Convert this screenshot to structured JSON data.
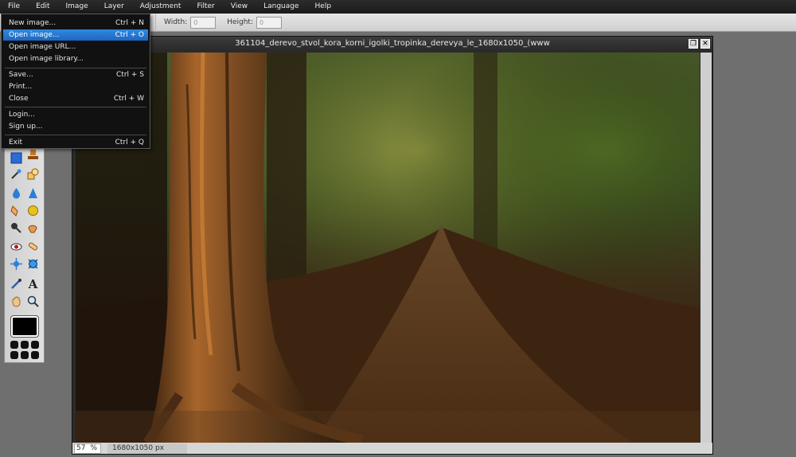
{
  "menubar": {
    "items": [
      "File",
      "Edit",
      "Image",
      "Layer",
      "Adjustment",
      "Filter",
      "View",
      "Language",
      "Help"
    ]
  },
  "options": {
    "width_label": "Width:",
    "width_value": "0",
    "height_label": "Height:",
    "height_value": "0"
  },
  "file_menu": {
    "items": [
      {
        "label": "New image...",
        "shortcut": "Ctrl + N"
      },
      {
        "label": "Open image...",
        "shortcut": "Ctrl + O"
      },
      {
        "label": "Open image URL...",
        "shortcut": ""
      },
      {
        "label": "Open image library...",
        "shortcut": ""
      },
      {
        "label": "Save...",
        "shortcut": "Ctrl + S"
      },
      {
        "label": "Print...",
        "shortcut": ""
      },
      {
        "label": "Close",
        "shortcut": "Ctrl + W"
      },
      {
        "label": "Login...",
        "shortcut": ""
      },
      {
        "label": "Sign up...",
        "shortcut": ""
      },
      {
        "label": "Exit",
        "shortcut": "Ctrl + Q"
      }
    ],
    "active_index": 1
  },
  "image_window": {
    "title": "361104_derevo_stvol_kora_korni_igolki_tropinka_derevya_le_1680x1050_(www",
    "restore_glyph": "❐",
    "close_glyph": "✕",
    "zoom_value": "57",
    "zoom_unit": "%",
    "dimensions": "1680x1050 px"
  },
  "tools": {
    "icons": [
      "marquee-tool-icon",
      "stamp-tool-icon",
      "wand-tool-icon",
      "shape-tool-icon",
      "blur-tool-icon",
      "sharpen-tool-icon",
      "smudge-tool-icon",
      "sponge-tool-icon",
      "dodge-tool-icon",
      "burn-tool-icon",
      "red-eye-tool-icon",
      "spot-heal-tool-icon",
      "bloat-tool-icon",
      "pinch-tool-icon",
      "color-picker-tool-icon",
      "type-tool-icon",
      "hand-tool-icon",
      "zoom-tool-icon"
    ],
    "type_glyph": "A"
  },
  "colors": {
    "menu_active": "#2f8ae0",
    "foreground": "#000000"
  }
}
